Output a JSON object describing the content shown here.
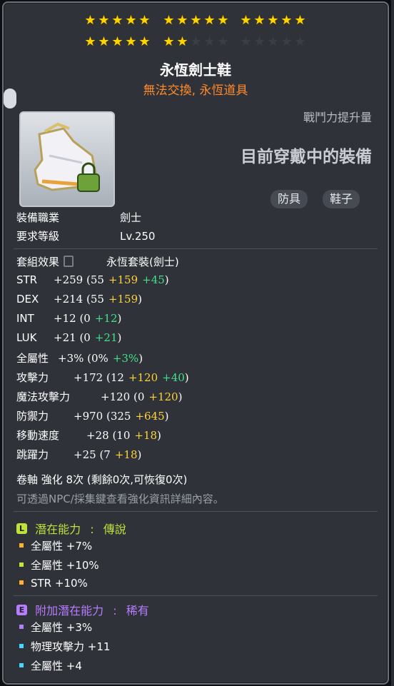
{
  "stars": {
    "filled": 22,
    "total": 30
  },
  "item": {
    "name": "永恆劍士鞋",
    "subtitle": "無法交換, 永恆道具",
    "power_label": "戰鬥力提升量",
    "equipped_text": "目前穿戴中的裝備",
    "tags": [
      "防具",
      "鞋子"
    ]
  },
  "requirements": {
    "job_label": "裝備職業",
    "job_value": "劍士",
    "level_label": "要求等級",
    "level_value": "Lv.250"
  },
  "set": {
    "label": "套組效果",
    "value": "永恆套裝(劍士)"
  },
  "stats": [
    {
      "name": "STR",
      "total": "+259",
      "open": "(55",
      "a": "+159",
      "b": "+45",
      "close": ")"
    },
    {
      "name": "DEX",
      "total": "+214",
      "open": "(55",
      "a": "+159",
      "b": "",
      "close": ")"
    },
    {
      "name": "INT",
      "total": "+12",
      "open": "(0",
      "a": "",
      "b": "+12",
      "close": ")"
    },
    {
      "name": "LUK",
      "total": "+21",
      "open": "(0",
      "a": "",
      "b": "+21",
      "close": ")"
    },
    {
      "name": "全屬性",
      "total": "+3%",
      "open": "(0%",
      "a": "",
      "b": "+3%",
      "close": ")"
    },
    {
      "name": "攻擊力",
      "total": "+172",
      "open": "(12",
      "a": "+120",
      "b": "+40",
      "close": ")"
    },
    {
      "name": "魔法攻擊力",
      "total": "+120",
      "open": "(0",
      "a": "+120",
      "b": "",
      "close": ")"
    },
    {
      "name": "防禦力",
      "total": "+970",
      "open": "(325",
      "a": "+645",
      "b": "",
      "close": ")"
    },
    {
      "name": "移動速度",
      "total": "+28",
      "open": "(10",
      "a": "+18",
      "b": "",
      "close": ")"
    },
    {
      "name": "跳躍力",
      "total": "+25",
      "open": "(7",
      "a": "+18",
      "b": "",
      "close": ")"
    }
  ],
  "scroll": {
    "line": "卷軸 強化 8次 (剩餘0次,可恢復0次)",
    "hint": "可透過NPC/採集鍵查看強化資訊詳細內容。"
  },
  "potential": {
    "badge": "L",
    "label": "潛在能力",
    "sep": ":",
    "grade": "傳說",
    "color": "#bfe23a",
    "lines": [
      "全屬性 +7%",
      "全屬性 +10%",
      "STR +10%"
    ],
    "bullet_colors": [
      "#ffb22a",
      "#c9e23a",
      "#ffb22a"
    ]
  },
  "bonus_potential": {
    "badge": "E",
    "label": "附加潛在能力",
    "sep": ":",
    "grade": "稀有",
    "color": "#b77cff",
    "lines": [
      "全屬性 +3%",
      "物理攻擊力 +11",
      "全屬性 +4"
    ],
    "bullet_colors": [
      "#b77cff",
      "#46d7ff",
      "#46d7ff"
    ]
  }
}
